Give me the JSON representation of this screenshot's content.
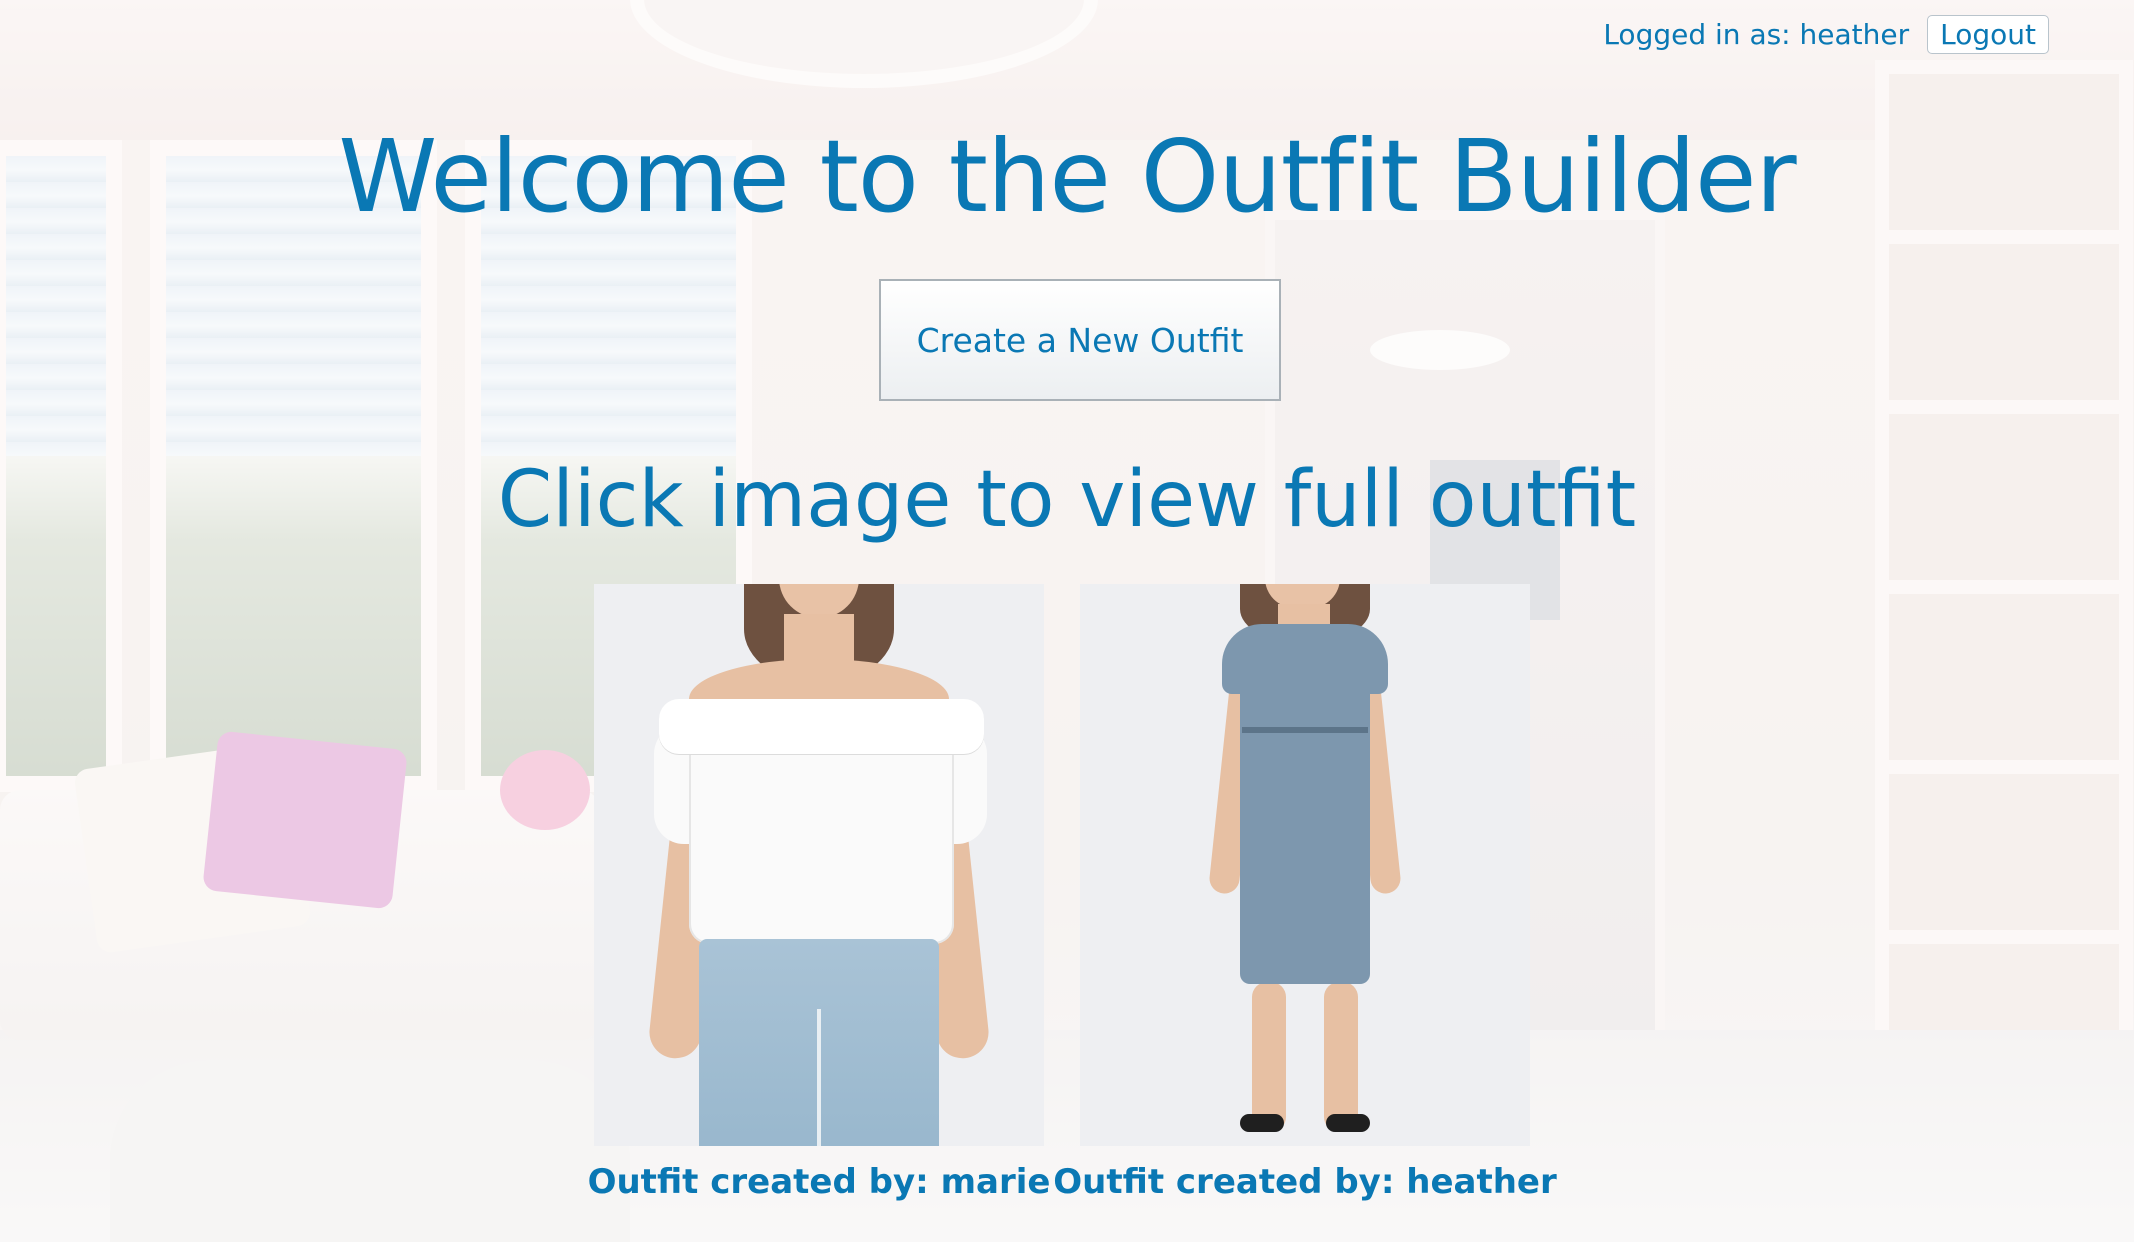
{
  "header": {
    "logged_in_label": "Logged in as: heather",
    "logout_label": "Logout"
  },
  "main": {
    "title": "Welcome to the Outfit Builder",
    "create_button_label": "Create a New Outfit",
    "subtitle": "Click image to view full outfit"
  },
  "outfits": [
    {
      "caption": "Outfit created by: marie"
    },
    {
      "caption": "Outfit created by: heather"
    }
  ],
  "colors": {
    "accent": "#0a78b4"
  }
}
